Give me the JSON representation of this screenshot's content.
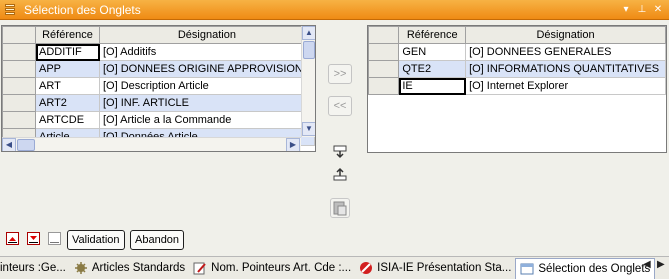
{
  "window": {
    "title": "Sélection des Onglets",
    "pin_icon": "pin-icon",
    "close_icon": "close-icon"
  },
  "left_grid": {
    "headers": [
      "Référence",
      "Désignation"
    ],
    "rows": [
      {
        "ref": "ADDITIF",
        "des": "[O] Additifs"
      },
      {
        "ref": "APP",
        "des": "[O] DONNEES ORIGINE APPROVISIONN"
      },
      {
        "ref": "ART",
        "des": "[O] Description Article"
      },
      {
        "ref": "ART2",
        "des": "[O] INF. ARTICLE"
      },
      {
        "ref": "ARTCDE",
        "des": "[O] Article a la Commande"
      },
      {
        "ref": "Article",
        "des": "[O] Données Article"
      }
    ]
  },
  "right_grid": {
    "headers": [
      "Référence",
      "Désignation"
    ],
    "rows": [
      {
        "ref": "GEN",
        "des": "[O] DONNEES GENERALES"
      },
      {
        "ref": "QTE2",
        "des": "[O] INFORMATIONS QUANTITATIVES"
      },
      {
        "ref": "IE",
        "des": "[O] Internet Explorer"
      }
    ]
  },
  "transfer": {
    "add_label": ">>",
    "remove_label": "<<"
  },
  "bottom": {
    "validate_label": "Validation",
    "cancel_label": "Abandon"
  },
  "tabs": [
    {
      "label": "inteurs :Ge...",
      "icon": ""
    },
    {
      "label": "Articles Standards",
      "icon": "gear-icon"
    },
    {
      "label": "Nom. Pointeurs Art. Cde :...",
      "icon": "document-pencil-icon"
    },
    {
      "label": "ISIA-IE Présentation Sta...",
      "icon": "no-entry-icon"
    },
    {
      "label": "Sélection des Onglets",
      "icon": "window-icon"
    }
  ],
  "colors": {
    "title_bar": "#ef8b14",
    "row_alt": "#d9e3f7"
  }
}
